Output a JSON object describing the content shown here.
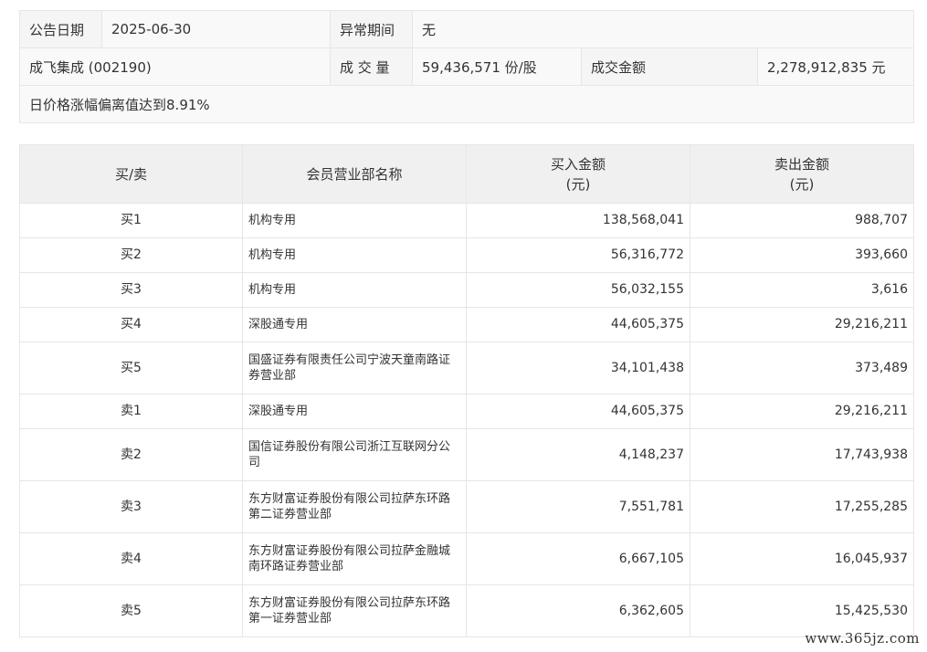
{
  "summary": {
    "date_label": "公告日期",
    "date_value": "2025-06-30",
    "period_label": "异常期间",
    "period_value": "无",
    "stock": "成飞集成 (002190)",
    "volume_label": "成 交 量",
    "volume_value": "59,436,571 份/股",
    "amount_label": "成交金额",
    "amount_value": "2,278,912,835 元",
    "reason": "日价格涨幅偏离值达到8.91%"
  },
  "table": {
    "headers": {
      "side": "买/卖",
      "member": "会员营业部名称",
      "buy_line1": "买入金额",
      "buy_line2": "(元)",
      "sell_line1": "卖出金额",
      "sell_line2": "(元)"
    },
    "rows": [
      {
        "side": "买1",
        "member": "机构专用",
        "buy": "138,568,041",
        "sell": "988,707"
      },
      {
        "side": "买2",
        "member": "机构专用",
        "buy": "56,316,772",
        "sell": "393,660"
      },
      {
        "side": "买3",
        "member": "机构专用",
        "buy": "56,032,155",
        "sell": "3,616"
      },
      {
        "side": "买4",
        "member": "深股通专用",
        "buy": "44,605,375",
        "sell": "29,216,211"
      },
      {
        "side": "买5",
        "member": "国盛证券有限责任公司宁波天童南路证券营业部",
        "buy": "34,101,438",
        "sell": "373,489"
      },
      {
        "side": "卖1",
        "member": "深股通专用",
        "buy": "44,605,375",
        "sell": "29,216,211"
      },
      {
        "side": "卖2",
        "member": "国信证券股份有限公司浙江互联网分公司",
        "buy": "4,148,237",
        "sell": "17,743,938"
      },
      {
        "side": "卖3",
        "member": "东方财富证券股份有限公司拉萨东环路第二证券营业部",
        "buy": "7,551,781",
        "sell": "17,255,285"
      },
      {
        "side": "卖4",
        "member": "东方财富证券股份有限公司拉萨金融城南环路证券营业部",
        "buy": "6,667,105",
        "sell": "16,045,937"
      },
      {
        "side": "卖5",
        "member": "东方财富证券股份有限公司拉萨东环路第一证券营业部",
        "buy": "6,362,605",
        "sell": "15,425,530"
      }
    ]
  },
  "watermark": "www.365jz.com"
}
